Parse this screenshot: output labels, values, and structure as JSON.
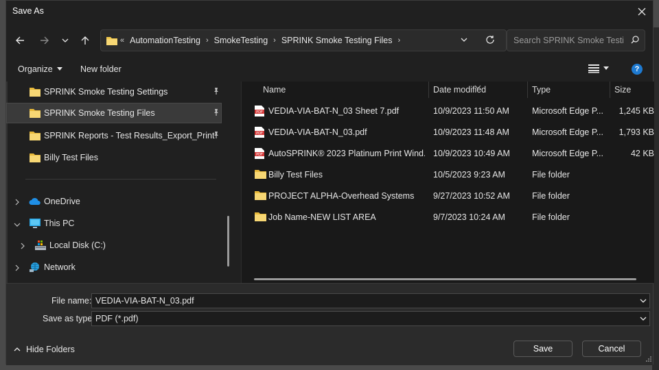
{
  "window": {
    "title": "Save As"
  },
  "address": {
    "crumbs": [
      "AutomationTesting",
      "SmokeTesting",
      "SPRINK Smoke Testing Files"
    ],
    "overflow": "«"
  },
  "search": {
    "placeholder": "Search SPRINK Smoke Testi..."
  },
  "commands": {
    "organize": "Organize",
    "new_folder": "New folder"
  },
  "sidebar": {
    "pinned": [
      {
        "label": "SPRINK Smoke Testing Settings",
        "pinned": true
      },
      {
        "label": "SPRINK Smoke Testing Files",
        "pinned": true,
        "selected": true
      },
      {
        "label": "SPRINK Reports - Test Results_Export_Print",
        "pinned": true
      },
      {
        "label": "Billy Test Files",
        "pinned": false
      }
    ],
    "tree": [
      {
        "label": "OneDrive",
        "icon": "cloud-icon"
      },
      {
        "label": "This PC",
        "icon": "monitor-icon",
        "expanded": true
      },
      {
        "label": "Local Disk (C:)",
        "icon": "disk-icon"
      },
      {
        "label": "Network",
        "icon": "network-icon"
      }
    ]
  },
  "columns": {
    "name": "Name",
    "date": "Date modified",
    "type": "Type",
    "size": "Size"
  },
  "files": [
    {
      "name": "VEDIA-VIA-BAT-N_03 Sheet 7.pdf",
      "date": "10/9/2023 11:50 AM",
      "type": "Microsoft Edge P...",
      "size": "1,245 KB",
      "kind": "pdf"
    },
    {
      "name": "VEDIA-VIA-BAT-N_03.pdf",
      "date": "10/9/2023 11:48 AM",
      "type": "Microsoft Edge P...",
      "size": "1,793 KB",
      "kind": "pdf"
    },
    {
      "name": "AutoSPRINK® 2023 Platinum Print Wind...",
      "date": "10/9/2023 10:49 AM",
      "type": "Microsoft Edge P...",
      "size": "42 KB",
      "kind": "pdf"
    },
    {
      "name": "Billy Test Files",
      "date": "10/5/2023 9:23 AM",
      "type": "File folder",
      "size": "",
      "kind": "folder"
    },
    {
      "name": "PROJECT ALPHA-Overhead Systems",
      "date": "9/27/2023 10:52 AM",
      "type": "File folder",
      "size": "",
      "kind": "folder"
    },
    {
      "name": "Job Name-NEW LIST AREA",
      "date": "9/7/2023 10:24 AM",
      "type": "File folder",
      "size": "",
      "kind": "folder"
    }
  ],
  "form": {
    "file_name_label": "File name:",
    "file_name_value": "VEDIA-VIA-BAT-N_03.pdf",
    "save_type_label": "Save as type:",
    "save_type_value": "PDF (*.pdf)"
  },
  "footer": {
    "hide_folders": "Hide Folders",
    "save": "Save",
    "cancel": "Cancel"
  },
  "colors": {
    "folder": "#f2c94c",
    "pdf": "#d63b3b",
    "accent": "#1e7ad1"
  }
}
